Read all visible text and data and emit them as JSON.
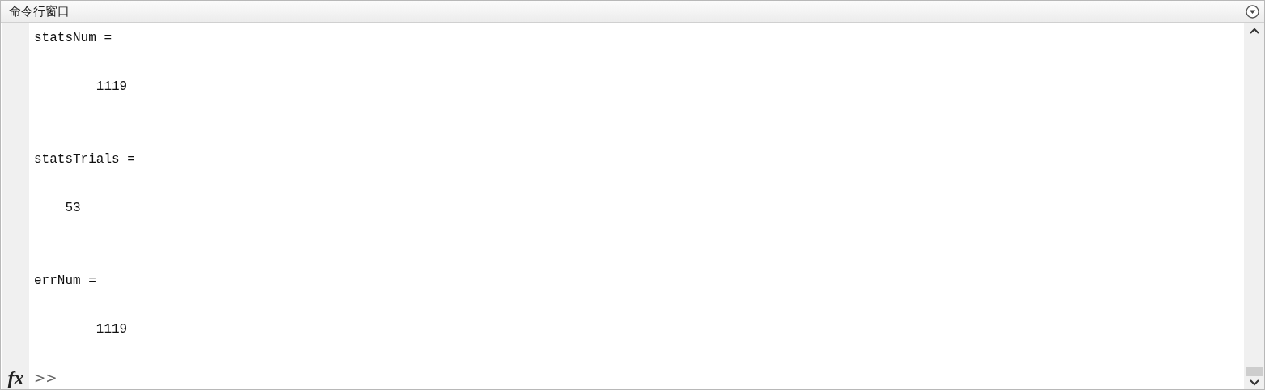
{
  "window": {
    "title": "命令行窗口"
  },
  "outputs": [
    {
      "variable": "statsNum =",
      "value": "        1119"
    },
    {
      "variable": "statsTrials =",
      "value": "    53"
    },
    {
      "variable": "errNum =",
      "value": "        1119"
    }
  ],
  "prompt": {
    "symbol": "fx",
    "text": ">>"
  }
}
